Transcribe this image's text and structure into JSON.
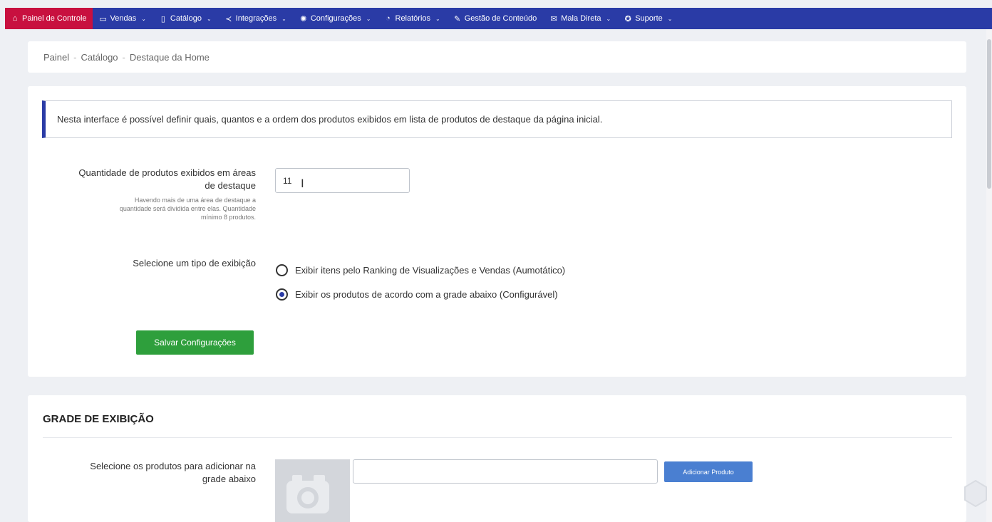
{
  "nav": {
    "items": [
      {
        "label": "Painel de Controle",
        "icon": "home-icon",
        "glyph": "⌂",
        "chevron": false
      },
      {
        "label": "Vendas",
        "icon": "folder-icon",
        "glyph": "▭",
        "chevron": true
      },
      {
        "label": "Catálogo",
        "icon": "book-icon",
        "glyph": "▯",
        "chevron": true
      },
      {
        "label": "Integrações",
        "icon": "share-icon",
        "glyph": "≺",
        "chevron": true
      },
      {
        "label": "Configurações",
        "icon": "gear-icon",
        "glyph": "✺",
        "chevron": true
      },
      {
        "label": "Relatórios",
        "icon": "clock-icon",
        "glyph": "◔",
        "chevron": true
      },
      {
        "label": "Gestão de Conteúdo",
        "icon": "edit-icon",
        "glyph": "✎",
        "chevron": false
      },
      {
        "label": "Mala Direta",
        "icon": "mail-icon",
        "glyph": "✉",
        "chevron": true
      },
      {
        "label": "Suporte",
        "icon": "support-icon",
        "glyph": "✪",
        "chevron": true
      }
    ],
    "chevron": "⌄"
  },
  "breadcrumb": {
    "items": [
      "Painel",
      "Catálogo",
      "Destaque da Home"
    ],
    "separator": "-"
  },
  "config": {
    "info_text": "Nesta interface é possível definir quais, quantos e a ordem dos produtos exibidos em lista de produtos de destaque da página inicial.",
    "quantity_label_line1": "Quantidade de produtos exibidos em áreas",
    "quantity_label_line2": "de destaque",
    "quantity_help_line1": "Havendo mais de uma área de destaque a",
    "quantity_help_line2": "quantidade será dividida entre elas. Quantidade",
    "quantity_help_line3": "mínimo 8 produtos.",
    "quantity_value": "11",
    "display_type_label": "Selecione um tipo de exibição",
    "option_auto": "Exibir itens pelo Ranking de Visualizações e Vendas (Aumotático)",
    "option_grid": "Exibir os produtos de acordo com a grade abaixo (Configurável)",
    "selected_option": "grid",
    "save_button": "Salvar Configurações"
  },
  "grid": {
    "title": "GRADE DE EXIBIÇÃO",
    "select_label_line1": "Selecione os produtos para adicionar na",
    "select_label_line2": "grade abaixo",
    "product_input_value": "",
    "add_button": "Adicionar Produto"
  },
  "colors": {
    "nav_bg": "#2a3ba6",
    "nav_active": "#c8103f",
    "save_green": "#2e9f3c",
    "add_blue": "#4a7fd1"
  }
}
